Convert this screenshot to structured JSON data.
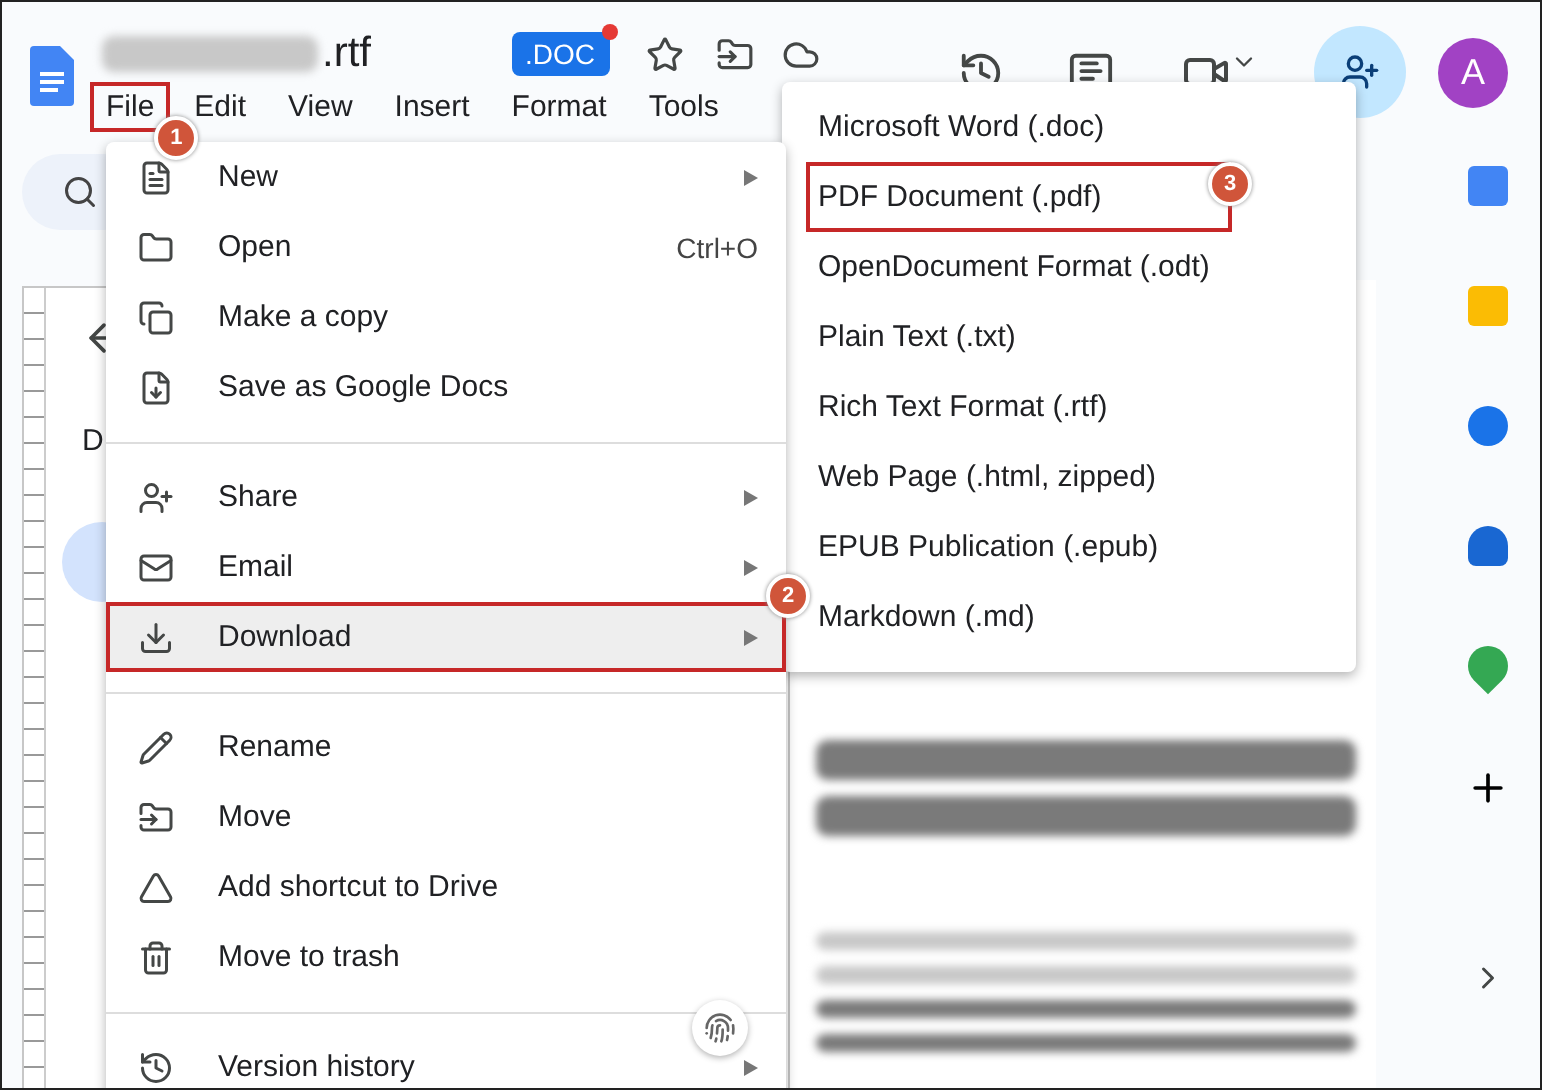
{
  "header": {
    "title": ".rtf",
    "doc_badge": ".DOC",
    "avatar": "A"
  },
  "menu_bar": [
    {
      "label": "File",
      "highlighted": true,
      "callout": "1"
    },
    {
      "label": "Edit",
      "highlighted": false
    },
    {
      "label": "View",
      "highlighted": false
    },
    {
      "label": "Insert",
      "highlighted": false
    },
    {
      "label": "Format",
      "highlighted": false
    },
    {
      "label": "Tools",
      "highlighted": false
    }
  ],
  "outline": {
    "heading": "D"
  },
  "file_menu": [
    {
      "kind": "item",
      "label": "New",
      "submenu": true,
      "highlighted": false
    },
    {
      "kind": "item",
      "label": "Open",
      "shortcut": "Ctrl+O",
      "submenu": false,
      "highlighted": false
    },
    {
      "kind": "item",
      "label": "Make a copy",
      "submenu": false,
      "highlighted": false
    },
    {
      "kind": "item",
      "label": "Save as Google Docs",
      "submenu": false,
      "highlighted": false
    },
    {
      "kind": "divider"
    },
    {
      "kind": "item",
      "label": "Share",
      "submenu": true,
      "highlighted": false
    },
    {
      "kind": "item",
      "label": "Email",
      "submenu": true,
      "highlighted": false
    },
    {
      "kind": "item",
      "label": "Download",
      "submenu": true,
      "highlighted": true,
      "callout": "2"
    },
    {
      "kind": "divider"
    },
    {
      "kind": "item",
      "label": "Rename",
      "submenu": false,
      "highlighted": false
    },
    {
      "kind": "item",
      "label": "Move",
      "submenu": false,
      "highlighted": false
    },
    {
      "kind": "item",
      "label": "Add shortcut to Drive",
      "submenu": false,
      "highlighted": false
    },
    {
      "kind": "item",
      "label": "Move to trash",
      "submenu": false,
      "highlighted": false
    },
    {
      "kind": "divider"
    },
    {
      "kind": "item",
      "label": "Version history",
      "submenu": true,
      "highlighted": false
    }
  ],
  "download_menu": [
    {
      "label": "Microsoft Word (.doc)",
      "highlighted": false
    },
    {
      "label": "PDF Document (.pdf)",
      "highlighted": true,
      "callout": "3"
    },
    {
      "label": "OpenDocument Format (.odt)",
      "highlighted": false
    },
    {
      "label": "Plain Text (.txt)",
      "highlighted": false
    },
    {
      "label": "Rich Text Format (.rtf)",
      "highlighted": false
    },
    {
      "label": "Web Page (.html, zipped)",
      "highlighted": false
    },
    {
      "label": "EPUB Publication (.epub)",
      "highlighted": false
    },
    {
      "label": "Markdown (.md)",
      "highlighted": false
    }
  ]
}
